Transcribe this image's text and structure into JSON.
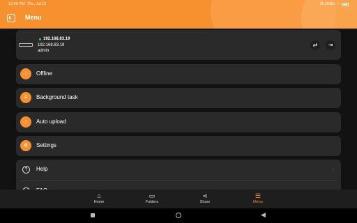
{
  "status": {
    "time": "12:00 PM",
    "date": "Thu, Jul 13",
    "speed": "15.2KB/s"
  },
  "header": {
    "title": "Menu"
  },
  "device": {
    "name": "192.168.83.19",
    "address": "192.168.83.19",
    "user": "admin"
  },
  "menu": [
    {
      "label": "Offline",
      "icon": "download-icon"
    },
    {
      "label": "Background task",
      "icon": "layers-icon"
    },
    {
      "label": "Auto upload",
      "icon": "upload-icon"
    },
    {
      "label": "Settings",
      "icon": "gear-icon"
    }
  ],
  "support": [
    {
      "label": "Help",
      "icon": "question-icon"
    },
    {
      "label": "FAQ",
      "icon": "people-icon"
    }
  ],
  "tabs": [
    {
      "label": "Home",
      "icon": "home-icon"
    },
    {
      "label": "Folders",
      "icon": "folder-icon"
    },
    {
      "label": "Share",
      "icon": "share-icon"
    },
    {
      "label": "Menu",
      "icon": "list-icon"
    }
  ],
  "colors": {
    "accent": "#f7902f",
    "online": "#3fcf5c"
  }
}
